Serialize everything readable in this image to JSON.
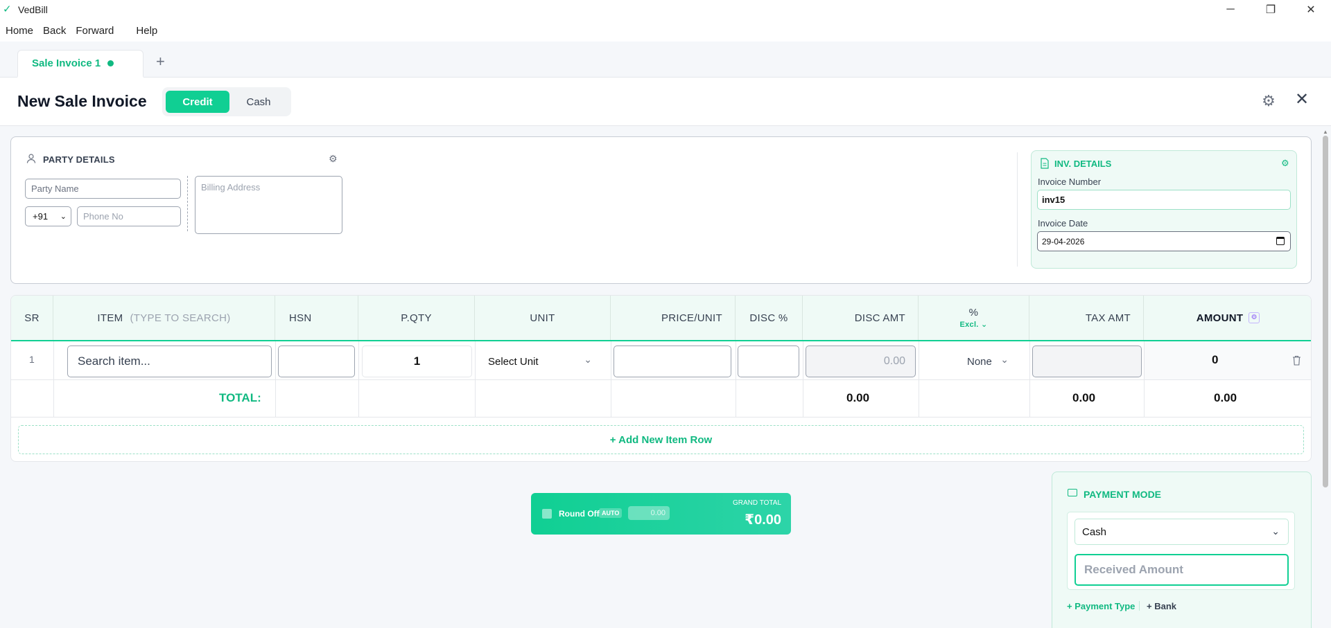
{
  "app": {
    "title": "VedBill"
  },
  "menu": {
    "home": "Home",
    "back": "Back",
    "forward": "Forward",
    "help": "Help"
  },
  "tabs": [
    {
      "label": "Sale Invoice 1"
    }
  ],
  "tab_add": "+",
  "header": {
    "title": "New Sale Invoice",
    "credit": "Credit",
    "cash": "Cash"
  },
  "party": {
    "title": "PARTY DETAILS",
    "name_placeholder": "Party Name",
    "country_code": "+91",
    "phone_placeholder": "Phone No",
    "billing_placeholder": "Billing Address"
  },
  "invoice": {
    "title": "INV. DETAILS",
    "number_label": "Invoice Number",
    "number_value": "inv15",
    "date_label": "Invoice Date",
    "date_value": "29-04-2026"
  },
  "table": {
    "headers": {
      "sr": "SR",
      "item": "ITEM",
      "item_hint": "(TYPE TO SEARCH)",
      "hsn": "HSN",
      "pqty": "P.QTY",
      "unit": "UNIT",
      "price": "PRICE/UNIT",
      "disc_pct": "DISC %",
      "disc_amt": "DISC AMT",
      "tax_pct": "%",
      "tax_mode": "Excl.",
      "tax_amt": "TAX AMT",
      "amount": "AMOUNT"
    },
    "row": {
      "sr": "1",
      "item_placeholder": "Search item...",
      "qty": "1",
      "unit": "Select Unit",
      "disc_amt_placeholder": "0.00",
      "tax": "None",
      "amount": "0"
    },
    "totals": {
      "label": "TOTAL:",
      "disc_amt": "0.00",
      "tax_amt": "0.00",
      "amount": "0.00"
    },
    "add_row": "+ Add New Item Row"
  },
  "grand_total": {
    "round_off": "Round Off",
    "auto": "AUTO",
    "round_value": "0.00",
    "label": "GRAND TOTAL",
    "value": "₹0.00"
  },
  "payment": {
    "title": "PAYMENT MODE",
    "mode": "Cash",
    "received_placeholder": "Received Amount",
    "add_type": "+ Payment Type",
    "add_bank": "+ Bank"
  },
  "colors": {
    "accent": "#10cf93",
    "accent_text": "#10b981"
  }
}
